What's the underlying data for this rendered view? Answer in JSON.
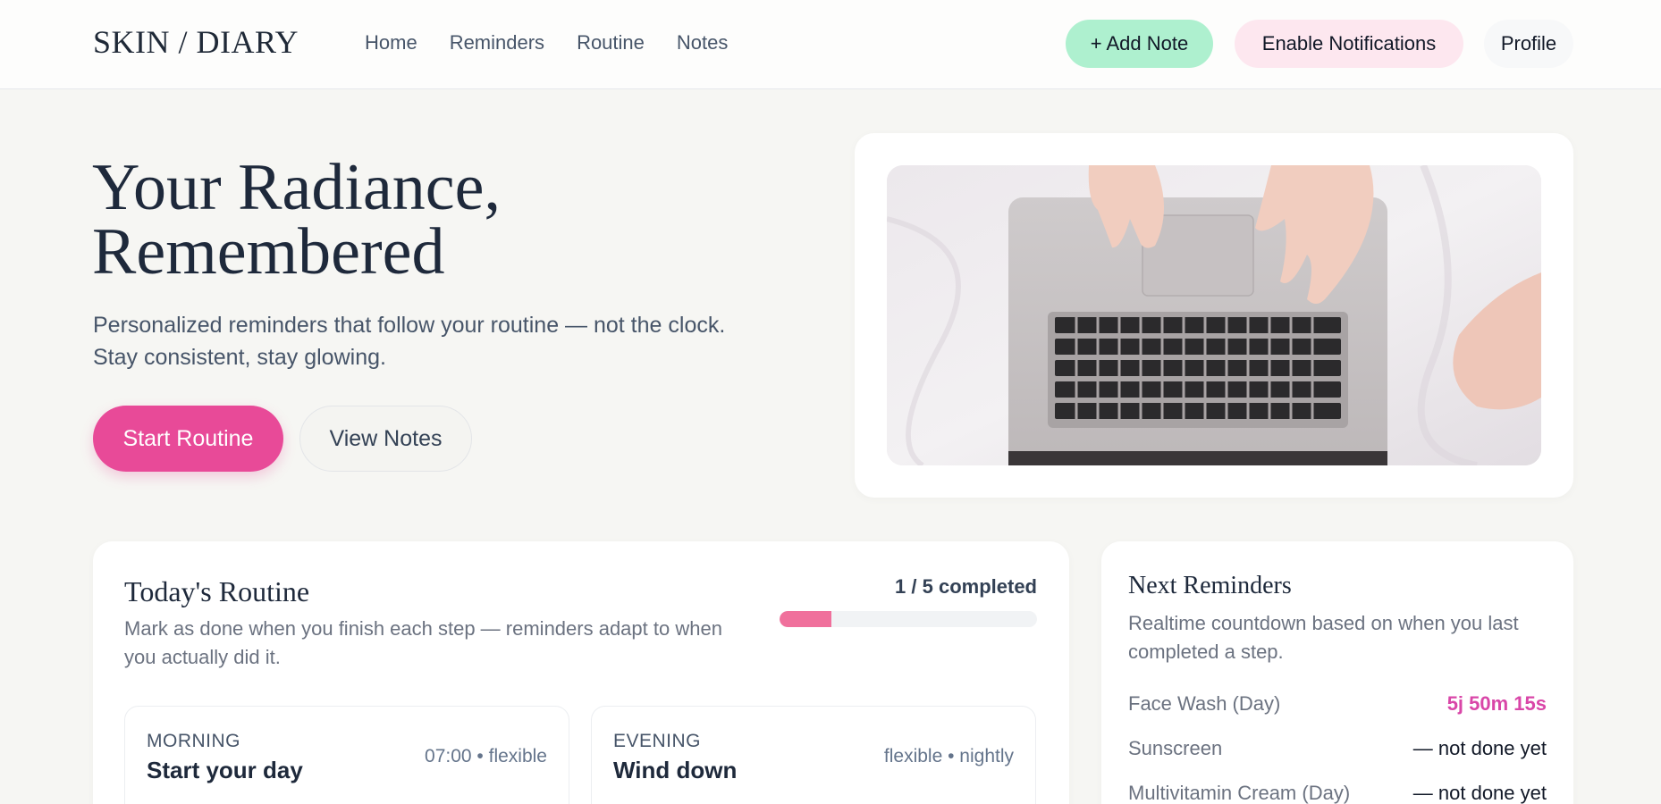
{
  "app": {
    "logo": "SKIN / DIARY"
  },
  "nav": {
    "items": [
      "Home",
      "Reminders",
      "Routine",
      "Notes"
    ]
  },
  "header_actions": {
    "add_note": "+ Add Note",
    "enable_notifications": "Enable Notifications",
    "profile": "Profile"
  },
  "hero": {
    "title_line1": "Your Radiance,",
    "title_line2": "Remembered",
    "subtitle_line1": "Personalized reminders that follow your routine — not the clock.",
    "subtitle_line2": "Stay consistent, stay glowing.",
    "primary_cta": "Start Routine",
    "secondary_cta": "View Notes"
  },
  "routine": {
    "title": "Today's Routine",
    "description": "Mark as done when you finish each step — reminders adapt to when you actually did it.",
    "progress_label": "1 / 5 completed",
    "progress_fraction": 0.2,
    "slots": [
      {
        "label": "MORNING",
        "name": "Start your day",
        "meta": "07:00 • flexible"
      },
      {
        "label": "EVENING",
        "name": "Wind down",
        "meta": "flexible • nightly"
      }
    ]
  },
  "reminders": {
    "title": "Next Reminders",
    "description": "Realtime countdown based on when you last completed a step.",
    "items": [
      {
        "name": "Face Wash (Day)",
        "value": "5j 50m 15s"
      },
      {
        "name": "Sunscreen",
        "value": "— not done yet"
      },
      {
        "name": "Multivitamin Cream (Day)",
        "value": "— not done yet"
      }
    ]
  },
  "colors": {
    "accent_pink": "#e84a98",
    "mint": "#aef0cf",
    "soft_pink": "#fde7ef",
    "progress": "#f0709c",
    "countdown": "#d946a8"
  }
}
